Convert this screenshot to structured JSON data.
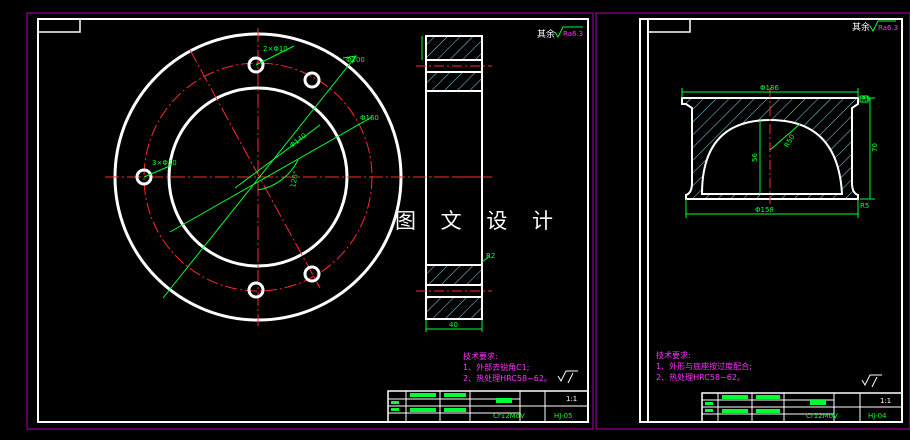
{
  "colors": {
    "background": "#000000",
    "outline": "#ffffff",
    "center_line": "#ff2a2a",
    "dimension": "#00ff33",
    "note": "#ff33ff",
    "sheet_border": "#b000b0",
    "hatch": "#7fd8ff"
  },
  "watermark": "图 文 设 计",
  "sheet1": {
    "roughness_note": "其余",
    "roughness_value": "Ra6.3",
    "dims": {
      "holes_small": "2×Φ10",
      "holes_large": "3×Φ10",
      "phi200": "Φ200",
      "phi160": "Φ160",
      "phi_bolt": "Φ140",
      "angle": "120°",
      "width": "40",
      "chamfer": "R2"
    },
    "notes_title": "技术要求:",
    "notes": [
      "1、外部去锐角C1;",
      "2、热处理HRC58~62。"
    ],
    "material": "Cr12MoV",
    "drawing_no": "HJ-05",
    "scale": "1:1"
  },
  "sheet2": {
    "roughness_note": "其余",
    "roughness_value": "Ra6.3",
    "dims": {
      "top": "Φ186",
      "bottom": "Φ158",
      "inner": "R50",
      "height": "70",
      "depth": "56",
      "edge_top": "R3",
      "edge_bottom": "R5"
    },
    "notes_title": "技术要求:",
    "notes": [
      "1、外形与底座按过度配合;",
      "2、热处理HRC58~62。"
    ],
    "material": "Cr12MoV",
    "drawing_no": "HJ-04",
    "scale": "1:1"
  }
}
